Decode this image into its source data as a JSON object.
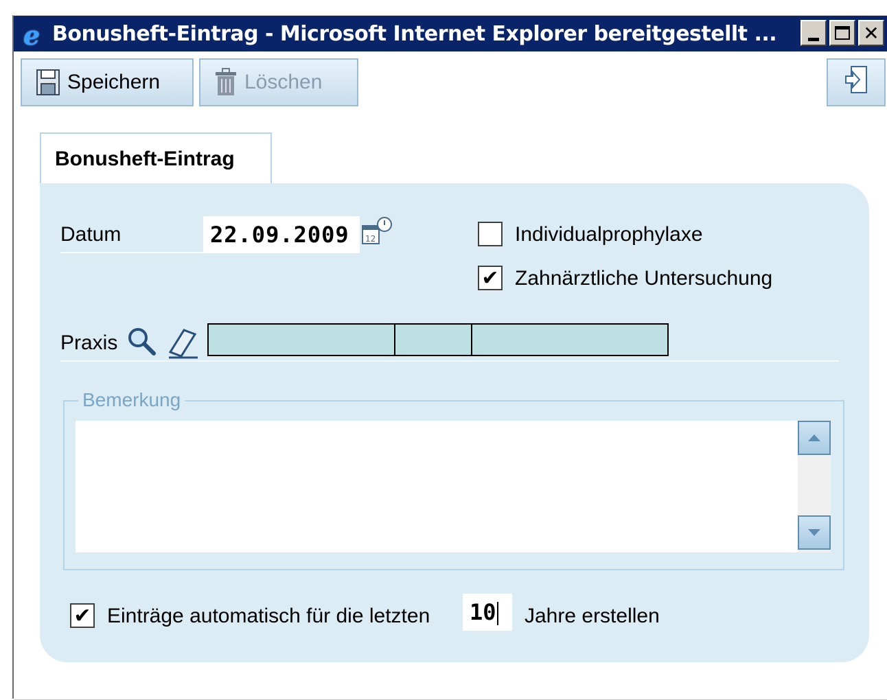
{
  "window": {
    "title": "Bonusheft-Eintrag - Microsoft Internet Explorer bereitgestellt ...",
    "logo": "e"
  },
  "toolbar": {
    "save_label": "Speichern",
    "delete_label": "Löschen"
  },
  "tab": {
    "label": "Bonusheft-Eintrag"
  },
  "form": {
    "datum_label": "Datum",
    "datum_value": "22.09.2009",
    "individualprophylaxe_label": "Individualprophylaxe",
    "individualprophylaxe_checked": false,
    "untersuchung_label": "Zahnärztliche Untersuchung",
    "untersuchung_checked": true,
    "praxis_label": "Praxis",
    "bemerkung_legend": "Bemerkung",
    "bemerkung_value": "",
    "auto_prefix": "Einträge automatisch für die letzten",
    "auto_years": "10",
    "auto_suffix": "Jahre erstellen",
    "auto_checked": true
  },
  "icons": [
    "ie-logo-icon",
    "minimize-icon",
    "maximize-icon",
    "close-icon",
    "save-icon",
    "trash-icon",
    "exit-icon",
    "calendar-icon",
    "search-icon",
    "eraser-icon",
    "scroll-up-icon",
    "scroll-down-icon"
  ],
  "colors": {
    "titlebar": "#0a246a",
    "panel": "#dcecf5",
    "praxis_field": "#bfe0e2"
  }
}
